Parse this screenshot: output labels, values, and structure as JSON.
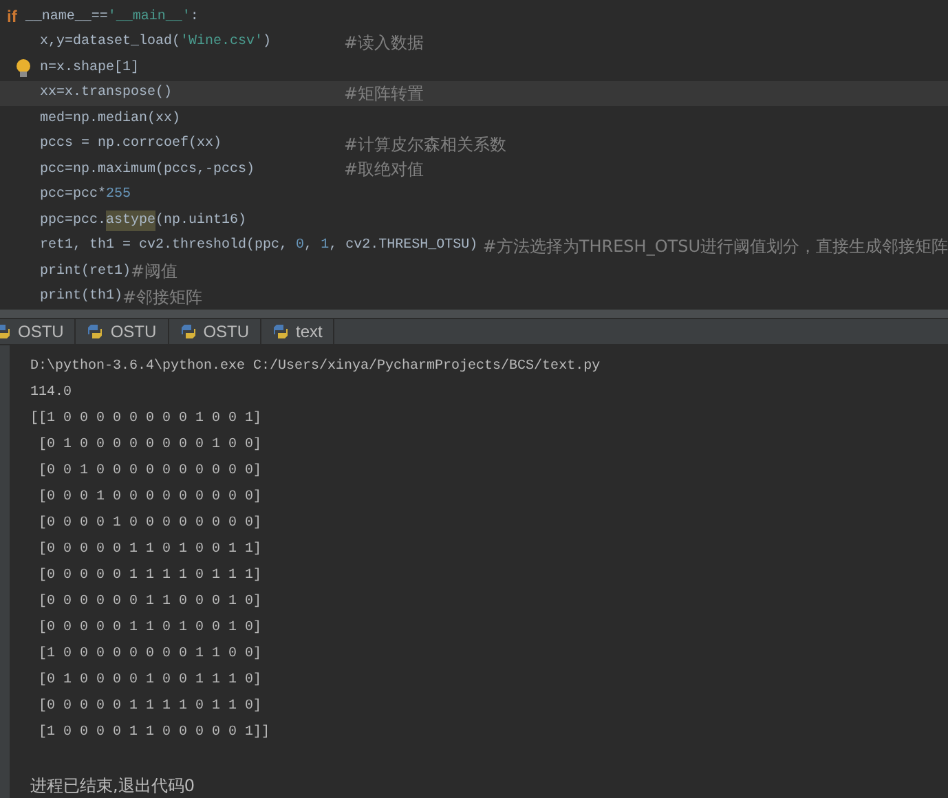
{
  "editor": {
    "lines": [
      {
        "tokens": [
          {
            "kind": "keyword",
            "text": "if"
          },
          {
            "kind": "plain",
            "text": " __name__=="
          },
          {
            "kind": "string",
            "text": "'__main__'"
          },
          {
            "kind": "plain",
            "text": ":"
          }
        ],
        "indented": false,
        "current": false,
        "bulb": false
      },
      {
        "tokens": [
          {
            "kind": "plain",
            "text": "x,y=dataset_load("
          },
          {
            "kind": "string",
            "text": "'Wine.csv'"
          },
          {
            "kind": "plain",
            "text": ")"
          }
        ],
        "comment": "#读入数据",
        "indented": true,
        "current": false,
        "bulb": false
      },
      {
        "tokens": [
          {
            "kind": "plain",
            "text": "n=x.shape[1]"
          }
        ],
        "indented": true,
        "current": false,
        "bulb": true
      },
      {
        "tokens": [
          {
            "kind": "plain",
            "text": "xx=x.transpose()"
          }
        ],
        "comment": "#矩阵转置",
        "indented": true,
        "current": true,
        "bulb": false
      },
      {
        "tokens": [
          {
            "kind": "plain",
            "text": "med=np.median(xx)"
          }
        ],
        "indented": true,
        "current": false,
        "bulb": false
      },
      {
        "tokens": [
          {
            "kind": "plain",
            "text": "pccs = np.corrcoef(xx)"
          }
        ],
        "comment": "#计算皮尔森相关系数",
        "indented": true,
        "current": false,
        "bulb": false
      },
      {
        "tokens": [
          {
            "kind": "plain",
            "text": "pcc=np.maximum(pccs,-pccs)"
          }
        ],
        "comment": "#取绝对值",
        "indented": true,
        "current": false,
        "bulb": false
      },
      {
        "tokens": [
          {
            "kind": "plain",
            "text": "pcc=pcc*"
          },
          {
            "kind": "number",
            "text": "255"
          }
        ],
        "indented": true,
        "current": false,
        "bulb": false
      },
      {
        "tokens": [
          {
            "kind": "plain",
            "text": "ppc=pcc."
          },
          {
            "kind": "highlight",
            "text": "astype"
          },
          {
            "kind": "plain",
            "text": "(np.uint16)"
          }
        ],
        "indented": true,
        "current": false,
        "bulb": false
      },
      {
        "tokens": [
          {
            "kind": "plain",
            "text": "ret1, th1 = cv2.threshold(ppc, "
          },
          {
            "kind": "number",
            "text": "0"
          },
          {
            "kind": "plain",
            "text": ", "
          },
          {
            "kind": "number",
            "text": "1"
          },
          {
            "kind": "plain",
            "text": ", cv2.THRESH_OTSU)"
          }
        ],
        "comment": "#方法选择为THRESH_OTSU进行阈值划分，直接生成邻接矩阵",
        "indented": true,
        "current": false,
        "bulb": false
      },
      {
        "tokens": [
          {
            "kind": "plain",
            "text": "print(ret1)"
          },
          {
            "kind": "comment",
            "text": "#阈值"
          }
        ],
        "indented": true,
        "current": false,
        "bulb": false
      },
      {
        "tokens": [
          {
            "kind": "plain",
            "text": "print(th1)"
          },
          {
            "kind": "comment",
            "text": "#邻接矩阵"
          }
        ],
        "indented": true,
        "current": false,
        "bulb": false
      }
    ]
  },
  "run_tabs": [
    {
      "label": "OSTU"
    },
    {
      "label": "OSTU"
    },
    {
      "label": "OSTU"
    },
    {
      "label": "text"
    }
  ],
  "console": {
    "lines": [
      "D:\\python-3.6.4\\python.exe C:/Users/xinya/PycharmProjects/BCS/text.py",
      "114.0",
      "[[1 0 0 0 0 0 0 0 0 1 0 0 1]",
      " [0 1 0 0 0 0 0 0 0 0 1 0 0]",
      " [0 0 1 0 0 0 0 0 0 0 0 0 0]",
      " [0 0 0 1 0 0 0 0 0 0 0 0 0]",
      " [0 0 0 0 1 0 0 0 0 0 0 0 0]",
      " [0 0 0 0 0 1 1 0 1 0 0 1 1]",
      " [0 0 0 0 0 1 1 1 1 0 1 1 1]",
      " [0 0 0 0 0 0 1 1 0 0 0 1 0]",
      " [0 0 0 0 0 1 1 0 1 0 0 1 0]",
      " [1 0 0 0 0 0 0 0 0 1 1 0 0]",
      " [0 1 0 0 0 0 1 0 0 1 1 1 0]",
      " [0 0 0 0 0 1 1 1 1 0 1 1 0]",
      " [1 0 0 0 0 1 1 0 0 0 0 0 1]]"
    ],
    "exit_message": "进程已结束,退出代码0"
  }
}
